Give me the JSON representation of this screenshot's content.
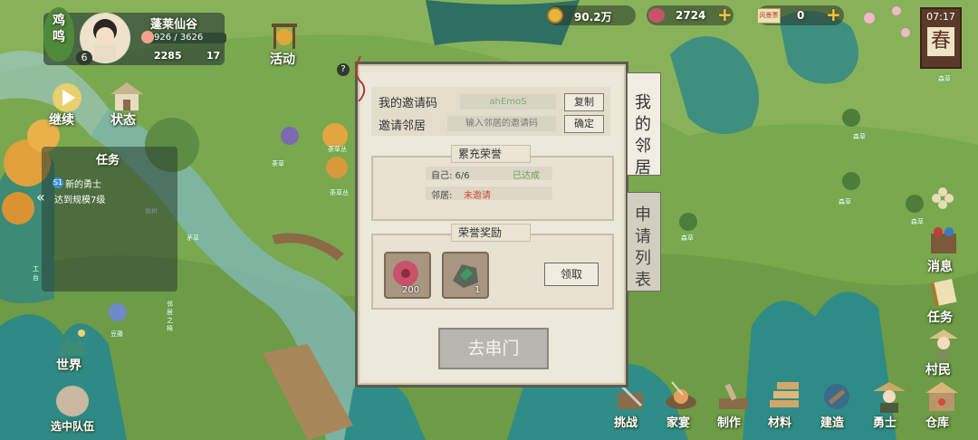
{
  "player": {
    "mood_label": "鸡鸣",
    "level": "6",
    "valley_name": "蓬莱仙谷",
    "reputation": "926 / 3626",
    "population": "2285",
    "buildings": "17"
  },
  "currency": {
    "coins": "90.2万",
    "gems": "2724",
    "tickets": "0",
    "ticket_icon_text": "风景票"
  },
  "clock": {
    "time": "07:17",
    "season": "春"
  },
  "left_menu": {
    "continue": "继续",
    "status": "状态",
    "activity": "活动",
    "world": "世界",
    "selected_team": "选中队伍"
  },
  "task_panel": {
    "title": "任务",
    "badge": "S1",
    "task_name": "新的勇士",
    "task_desc": "达到规模7级"
  },
  "right_menu": {
    "message": "消息",
    "quests": "任务",
    "villagers": "村民"
  },
  "bottom_bar": [
    "挑战",
    "家宴",
    "制作",
    "材料",
    "建造",
    "勇士",
    "仓库"
  ],
  "map_labels": [
    "世界",
    "荼草",
    "荼草丛",
    "荼草丛",
    "茅草",
    "翁树",
    "工台",
    "邻居之椅",
    "豆藤",
    "森草",
    "森草",
    "森草",
    "森草",
    "森草"
  ],
  "dialog": {
    "invite_code_label": "我的邀请码",
    "invite_code": "ahEmoS",
    "copy_btn": "复制",
    "invite_neighbor_label": "邀请邻居",
    "invite_placeholder": "输入邻居的邀请码",
    "confirm_btn": "确定",
    "honor_title": "累充荣誉",
    "self_label": "自己: 6/6",
    "self_status": "已达成",
    "neighbor_label": "邻居:",
    "neighbor_status": "未邀请",
    "reward_title": "荣誉奖励",
    "reward1_qty": "200",
    "reward2_qty": "1",
    "claim_btn": "领取",
    "visit_btn": "去串门",
    "tab_neighbors": "我的邻居",
    "tab_apply": "申请列表"
  },
  "colors": {
    "panel_bg": "#e9e4d4",
    "achieved": "#6aa358",
    "not_invited": "#d24b3b",
    "coin": "#e6b540",
    "gem": "#c85268"
  }
}
